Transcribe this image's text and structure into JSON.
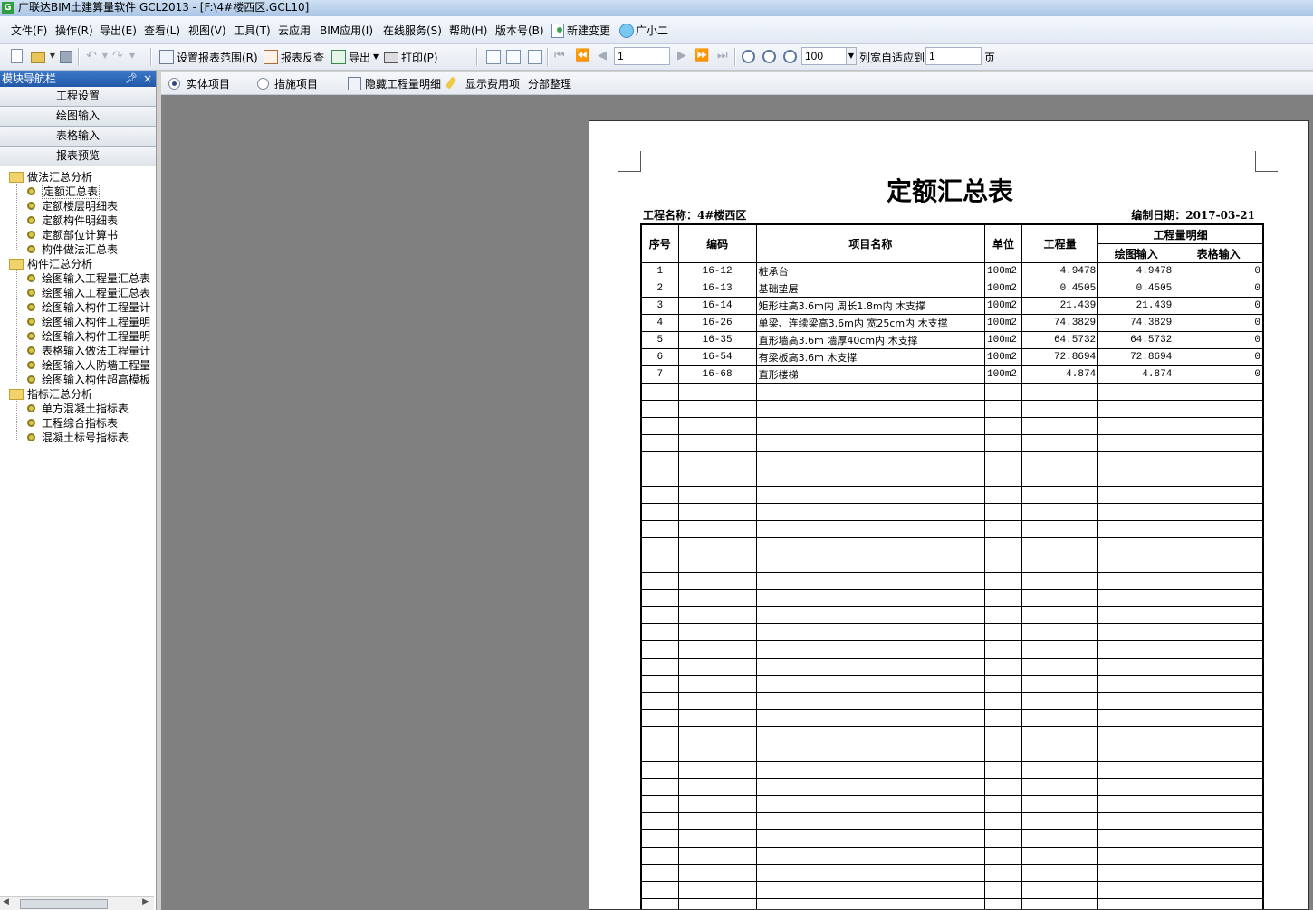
{
  "window": {
    "title": "广联达BIM土建算量软件 GCL2013 - [F:\\4#楼西区.GCL10]"
  },
  "menu": [
    "文件(F)",
    "操作(R)",
    "导出(E)",
    "查看(L)",
    "视图(V)",
    "工具(T)",
    "云应用",
    "BIM应用(I)",
    "在线服务(S)",
    "帮助(H)",
    "版本号(B)",
    "新建变更",
    "广小二"
  ],
  "toolbar": {
    "set_range": "设置报表范围(R)",
    "report_check": "报表反查",
    "export": "导出",
    "print": "打印(P)",
    "page_value": "1",
    "zoom_value": "100",
    "fit_columns": "列宽自适应到",
    "fit_value": "1",
    "page_unit": "页"
  },
  "nav": {
    "header": "模块导航栏",
    "tabs": [
      "工程设置",
      "绘图输入",
      "表格输入",
      "报表预览"
    ],
    "tree": [
      {
        "type": "folder",
        "label": "做法汇总分析"
      },
      {
        "type": "leaf",
        "label": "定额汇总表",
        "selected": true
      },
      {
        "type": "leaf",
        "label": "定额楼层明细表"
      },
      {
        "type": "leaf",
        "label": "定额构件明细表"
      },
      {
        "type": "leaf",
        "label": "定额部位计算书"
      },
      {
        "type": "leaf",
        "label": "构件做法汇总表"
      },
      {
        "type": "folder",
        "label": "构件汇总分析"
      },
      {
        "type": "leaf",
        "label": "绘图输入工程量汇总表"
      },
      {
        "type": "leaf",
        "label": "绘图输入工程量汇总表"
      },
      {
        "type": "leaf",
        "label": "绘图输入构件工程量计"
      },
      {
        "type": "leaf",
        "label": "绘图输入构件工程量明"
      },
      {
        "type": "leaf",
        "label": "绘图输入构件工程量明"
      },
      {
        "type": "leaf",
        "label": "表格输入做法工程量计"
      },
      {
        "type": "leaf",
        "label": "绘图输入人防墙工程量"
      },
      {
        "type": "leaf",
        "label": "绘图输入构件超高模板"
      },
      {
        "type": "folder",
        "label": "指标汇总分析"
      },
      {
        "type": "leaf",
        "label": "单方混凝土指标表"
      },
      {
        "type": "leaf",
        "label": "工程综合指标表"
      },
      {
        "type": "leaf",
        "label": "混凝土标号指标表"
      }
    ]
  },
  "options": {
    "entity_items": "实体项目",
    "measure_items": "措施项目",
    "hide_detail": "隐藏工程量明细",
    "show_fees": "显示费用项",
    "sort_parts": "分部整理"
  },
  "report": {
    "title": "定额汇总表",
    "project_label": "工程名称：4#楼西区",
    "date_label": "编制日期：2017-03-21",
    "headers": {
      "seq": "序号",
      "code": "编码",
      "name": "项目名称",
      "unit": "单位",
      "qty": "工程量",
      "detail": "工程量明细",
      "drawing": "绘图输入",
      "table": "表格输入"
    },
    "rows": [
      {
        "seq": "1",
        "code": "16-12",
        "name": "桩承台",
        "unit": "100m2",
        "qty": "4.9478",
        "drawing": "4.9478",
        "table": "0"
      },
      {
        "seq": "2",
        "code": "16-13",
        "name": "基础垫层",
        "unit": "100m2",
        "qty": "0.4505",
        "drawing": "0.4505",
        "table": "0"
      },
      {
        "seq": "3",
        "code": "16-14",
        "name": "矩形柱高3.6m内 周长1.8m内 木支撑",
        "unit": "100m2",
        "qty": "21.439",
        "drawing": "21.439",
        "table": "0"
      },
      {
        "seq": "4",
        "code": "16-26",
        "name": "单梁、连续梁高3.6m内 宽25cm内 木支撑",
        "unit": "100m2",
        "qty": "74.3829",
        "drawing": "74.3829",
        "table": "0"
      },
      {
        "seq": "5",
        "code": "16-35",
        "name": "直形墙高3.6m 墙厚40cm内 木支撑",
        "unit": "100m2",
        "qty": "64.5732",
        "drawing": "64.5732",
        "table": "0"
      },
      {
        "seq": "6",
        "code": "16-54",
        "name": "有梁板高3.6m 木支撑",
        "unit": "100m2",
        "qty": "72.8694",
        "drawing": "72.8694",
        "table": "0"
      },
      {
        "seq": "7",
        "code": "16-68",
        "name": "直形楼梯",
        "unit": "100m2",
        "qty": "4.874",
        "drawing": "4.874",
        "table": "0"
      }
    ]
  }
}
